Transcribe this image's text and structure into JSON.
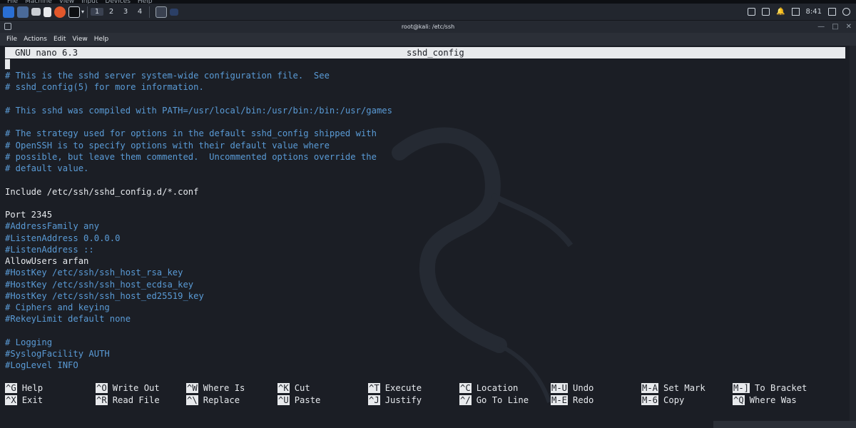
{
  "vm_menu": [
    "File",
    "Machine",
    "View",
    "Input",
    "Devices",
    "Help"
  ],
  "panel": {
    "workspaces": [
      "1",
      "2",
      "3",
      "4"
    ],
    "clock": "8:41"
  },
  "window": {
    "title": "root@kali: /etc/ssh"
  },
  "term_menu": [
    "File",
    "Actions",
    "Edit",
    "View",
    "Help"
  ],
  "nano": {
    "version": "GNU nano 6.3",
    "filename": "sshd_config",
    "lines": [
      {
        "text": "# This is the sshd server system-wide configuration file.  See",
        "type": "comment"
      },
      {
        "text": "# sshd_config(5) for more information.",
        "type": "comment"
      },
      {
        "text": "",
        "type": "blank"
      },
      {
        "text": "# This sshd was compiled with PATH=/usr/local/bin:/usr/bin:/bin:/usr/games",
        "type": "comment"
      },
      {
        "text": "",
        "type": "blank"
      },
      {
        "text": "# The strategy used for options in the default sshd_config shipped with",
        "type": "comment"
      },
      {
        "text": "# OpenSSH is to specify options with their default value where",
        "type": "comment"
      },
      {
        "text": "# possible, but leave them commented.  Uncommented options override the",
        "type": "comment"
      },
      {
        "text": "# default value.",
        "type": "comment"
      },
      {
        "text": "",
        "type": "blank"
      },
      {
        "text": "Include /etc/ssh/sshd_config.d/*.conf",
        "type": "normal"
      },
      {
        "text": "",
        "type": "blank"
      },
      {
        "text": "Port 2345",
        "type": "normal"
      },
      {
        "text": "#AddressFamily any",
        "type": "comment"
      },
      {
        "text": "#ListenAddress 0.0.0.0",
        "type": "comment"
      },
      {
        "text": "#ListenAddress ::",
        "type": "comment"
      },
      {
        "text": "AllowUsers arfan",
        "type": "normal"
      },
      {
        "text": "#HostKey /etc/ssh/ssh_host_rsa_key",
        "type": "comment"
      },
      {
        "text": "#HostKey /etc/ssh/ssh_host_ecdsa_key",
        "type": "comment"
      },
      {
        "text": "#HostKey /etc/ssh/ssh_host_ed25519_key",
        "type": "comment"
      },
      {
        "text": "# Ciphers and keying",
        "type": "comment"
      },
      {
        "text": "#RekeyLimit default none",
        "type": "comment"
      },
      {
        "text": "",
        "type": "blank"
      },
      {
        "text": "# Logging",
        "type": "comment"
      },
      {
        "text": "#SyslogFacility AUTH",
        "type": "comment"
      },
      {
        "text": "#LogLevel INFO",
        "type": "comment"
      }
    ],
    "shortcuts": [
      [
        {
          "key": "^G",
          "label": "Help"
        },
        {
          "key": "^X",
          "label": "Exit"
        }
      ],
      [
        {
          "key": "^O",
          "label": "Write Out"
        },
        {
          "key": "^R",
          "label": "Read File"
        }
      ],
      [
        {
          "key": "^W",
          "label": "Where Is"
        },
        {
          "key": "^\\",
          "label": "Replace"
        }
      ],
      [
        {
          "key": "^K",
          "label": "Cut"
        },
        {
          "key": "^U",
          "label": "Paste"
        }
      ],
      [
        {
          "key": "^T",
          "label": "Execute"
        },
        {
          "key": "^J",
          "label": "Justify"
        }
      ],
      [
        {
          "key": "^C",
          "label": "Location"
        },
        {
          "key": "^/",
          "label": "Go To Line"
        }
      ],
      [
        {
          "key": "M-U",
          "label": "Undo"
        },
        {
          "key": "M-E",
          "label": "Redo"
        }
      ],
      [
        {
          "key": "M-A",
          "label": "Set Mark"
        },
        {
          "key": "M-6",
          "label": "Copy"
        }
      ],
      [
        {
          "key": "M-]",
          "label": "To Bracket"
        },
        {
          "key": "^Q",
          "label": "Where Was"
        }
      ]
    ]
  },
  "colors": {
    "comment": "#5a9bd6",
    "text": "#e6e9ed",
    "background": "#1b1e25",
    "header_bg": "#e8eaed"
  }
}
